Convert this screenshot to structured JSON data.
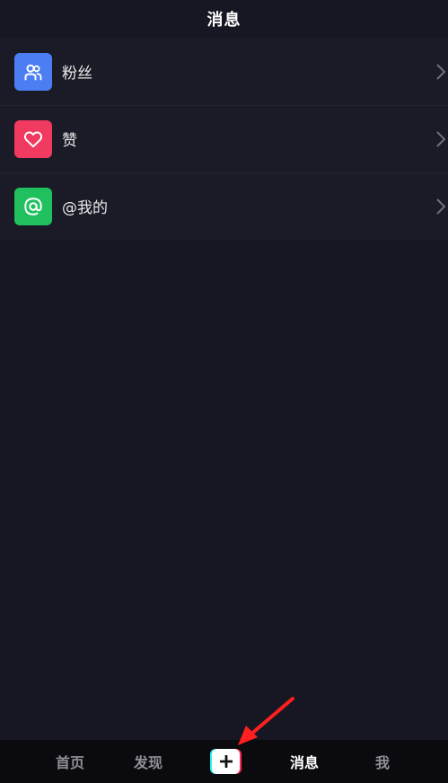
{
  "header": {
    "title": "消息"
  },
  "list": {
    "items": [
      {
        "label": "粉丝",
        "icon": "fans-icon",
        "color": "#4c7ef3"
      },
      {
        "label": "赞",
        "icon": "heart-icon",
        "color": "#f03a5f"
      },
      {
        "label": "@我的",
        "icon": "at-icon",
        "color": "#21c05e"
      }
    ]
  },
  "tabbar": {
    "home": "首页",
    "discover": "发现",
    "create_icon": "plus-icon",
    "messages": "消息",
    "me": "我"
  },
  "colors": {
    "background": "#161722",
    "list_background": "#1a1b26",
    "tabbar_background": "#0b0b0f",
    "active_tab": "#ffffff",
    "inactive_tab": "#8f8f95",
    "annotation_arrow": "#ff1f1f"
  }
}
